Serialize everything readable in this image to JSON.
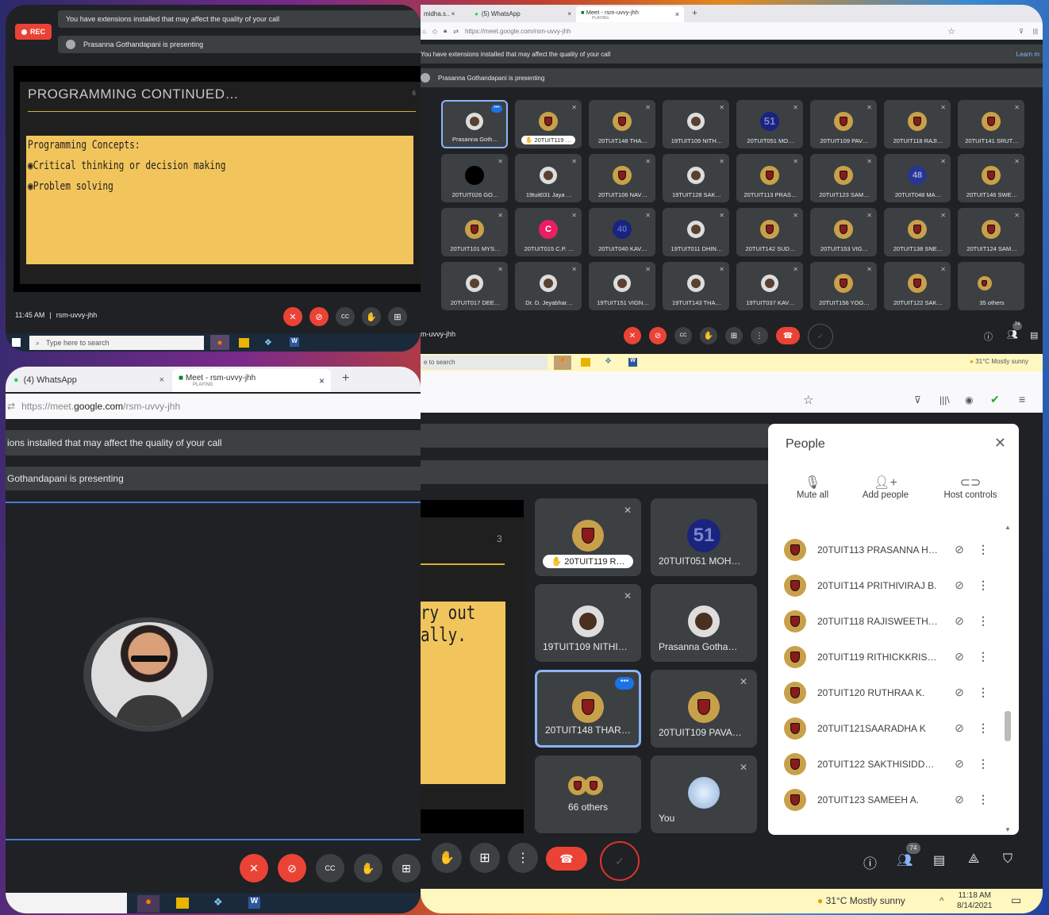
{
  "p1": {
    "toast1": "You have extensions installed that may affect the quality of your call",
    "toast2": "Prasanna Gothandapani is presenting",
    "rec": "REC",
    "slide_title": "PROGRAMMING CONTINUED…",
    "slide_num": "6",
    "slide_heading": "Programming Concepts:",
    "bullets": [
      "Critical thinking or decision making",
      "Problem solving"
    ],
    "time": "11:45 AM",
    "sep": "|",
    "meeting": "rsm-uvvy-jhh",
    "search_placeholder": "Type here to search"
  },
  "p2": {
    "tabs": [
      "midha.s..",
      "(5) WhatsApp",
      "Meet - rsm-uvvy-jhh"
    ],
    "tab_sub": "PLAYING",
    "url": "https://meet.google.com/rsm-uvvy-jhh",
    "toast1": "You have extensions installed that may affect the quality of your call",
    "learn": "Learn m",
    "toast2": "Prasanna Gothandapani is presenting",
    "tiles": [
      [
        "Prasanna Goth…",
        "20TUIT119 …",
        "20TUIT148 THA…",
        "19TUIT109 NITH…",
        "20TUIT051 MO…",
        "20TUIT109 PAV…",
        "20TUIT118 RAJI…",
        "20TUIT141 SRUT…"
      ],
      [
        "20TUIT026 GO…",
        "19tuit031 Jaya …",
        "20TUIT106 NAV…",
        "19TUIT128 SAK…",
        "20TUIT113 PRAS…",
        "20TUIT123 SAM…",
        "20TUIT048 MA…",
        "20TUIT146 SWE…"
      ],
      [
        "20TUIT101 MYS…",
        "20TUIT015 C.P. …",
        "20TUIT040 KAV…",
        "19TUIT011 DHIN…",
        "20TUIT142 SUD…",
        "20TUIT153 VIG…",
        "20TUIT138 SNE…",
        "20TUIT124 SAM…"
      ],
      [
        "20TUIT017 DEE…",
        "Dr. D. Jeyabhar…",
        "19TUIT151 VIGN…",
        "19TUIT143 THA…",
        "19TUIT037 KAV…",
        "20TUIT156 YOG…",
        "20TUIT122 SAK…",
        "35 others"
      ]
    ],
    "num51": "51",
    "num48": "48",
    "num40": "40",
    "c_letter": "C",
    "meeting": "m-uvvy-jhh",
    "count": "74",
    "search": "e to search",
    "weather": "31°C  Mostly sunny"
  },
  "p3": {
    "tabs": [
      "(4) WhatsApp",
      "Meet - rsm-uvvy-jhh"
    ],
    "tab_sub": "PLAYING",
    "url_pre": "https://meet.",
    "url_host": "google.com",
    "url_post": "/rsm-uvvy-jhh",
    "toast1": "ions installed that may affect the quality of your call",
    "toast2": "Gothandapani is presenting"
  },
  "p4": {
    "slide_num": "3",
    "slide_text": [
      "ry out",
      "ally."
    ],
    "tiles": [
      "20TUIT119 R…",
      "20TUIT051 MOH…",
      "19TUIT109 NITHI…",
      "Prasanna Gotha…",
      "20TUIT148 THAR…",
      "20TUIT109 PAVA…",
      "66 others",
      "You"
    ],
    "num51": "51",
    "people": {
      "title": "People",
      "close": "✕",
      "actions": [
        "Mute all",
        "Add people",
        "Host controls"
      ],
      "list": [
        "20TUIT113 PRASANNA H…",
        "20TUIT114 PRITHIVIRAJ B.",
        "20TUIT118 RAJISWEETH…",
        "20TUIT119 RITHICKKRIS…",
        "20TUIT120 RUTHRAA K.",
        "20TUIT121SAARADHA K",
        "20TUIT122 SAKTHISIDD…",
        "20TUIT123 SAMEEH A."
      ]
    },
    "count": "74",
    "weather": "31°C  Mostly sunny",
    "time": "11:18 AM",
    "date": "8/14/2021"
  }
}
